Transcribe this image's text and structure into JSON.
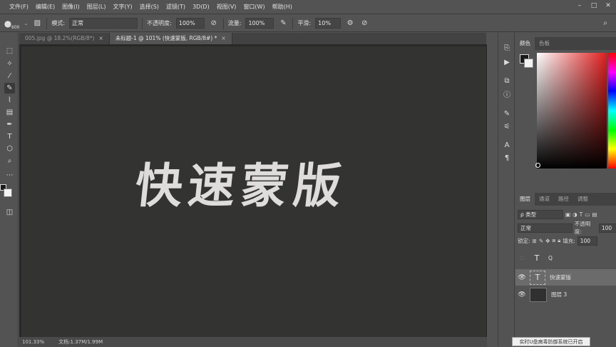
{
  "menu": [
    "文件(F)",
    "编辑(E)",
    "图像(I)",
    "图层(L)",
    "文字(Y)",
    "选择(S)",
    "滤镜(T)",
    "3D(D)",
    "视图(V)",
    "窗口(W)",
    "帮助(H)"
  ],
  "options": {
    "brush_size": "600",
    "mode_label": "模式:",
    "mode_value": "正常",
    "opacity_label": "不透明度:",
    "opacity_value": "100%",
    "flow_label": "流量:",
    "flow_value": "100%",
    "smooth_label": "平滑:",
    "smooth_value": "10%"
  },
  "tabs": [
    {
      "label": "005.jpg @ 18.2%(RGB/8*)",
      "close": "×"
    },
    {
      "label": "未标题-1 @ 101% (快速蒙版, RGB/8#) *",
      "close": "×"
    }
  ],
  "canvas": {
    "text": "快速蒙版"
  },
  "status": {
    "zoom": "101.33%",
    "doc": "文档:1.37M/1.99M"
  },
  "color_panel": {
    "tabs": [
      "颜色",
      "色板"
    ]
  },
  "layers_panel": {
    "tabs": [
      "图层",
      "通道",
      "路径",
      "调整"
    ],
    "filter_label": "ρ 类型",
    "blend_mode": "正常",
    "opacity_label": "不透明度:",
    "opacity_value": "100",
    "lock_label": "锁定:",
    "fill_label": "填充:",
    "fill_value": "100",
    "layers": [
      {
        "name": "Q",
        "thumb": "T",
        "visible": false
      },
      {
        "name": "快速蒙版",
        "thumb": "T",
        "visible": true
      },
      {
        "name": "图层 3",
        "thumb": "",
        "visible": true
      }
    ]
  },
  "notification": "实时U盘病毒防御系统已开启"
}
